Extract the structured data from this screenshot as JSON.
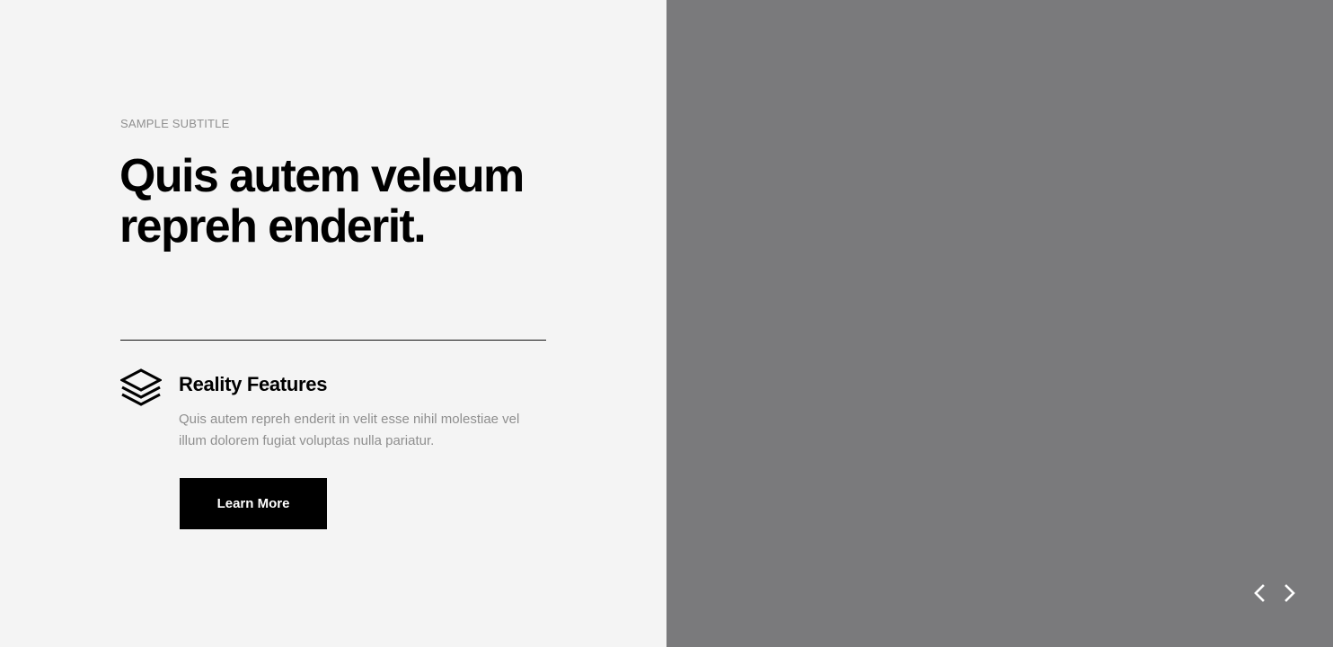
{
  "hero": {
    "subtitle": "SAMPLE SUBTITLE",
    "title": "Quis autem veleum repreh enderit."
  },
  "feature": {
    "icon": "layers-icon",
    "title": "Reality Features",
    "description": "Quis autem repreh enderit in velit esse nihil molestiae vel illum dolorem fugiat voluptas nulla pariatur."
  },
  "cta": {
    "label": "Learn More"
  },
  "slider": {
    "prev_icon": "chevron-left-icon",
    "next_icon": "chevron-right-icon"
  },
  "colors": {
    "left_background": "#f4f4f4",
    "image_placeholder": "#7a7a7c",
    "button_background": "#000000",
    "muted_text": "#8f8f8f"
  }
}
